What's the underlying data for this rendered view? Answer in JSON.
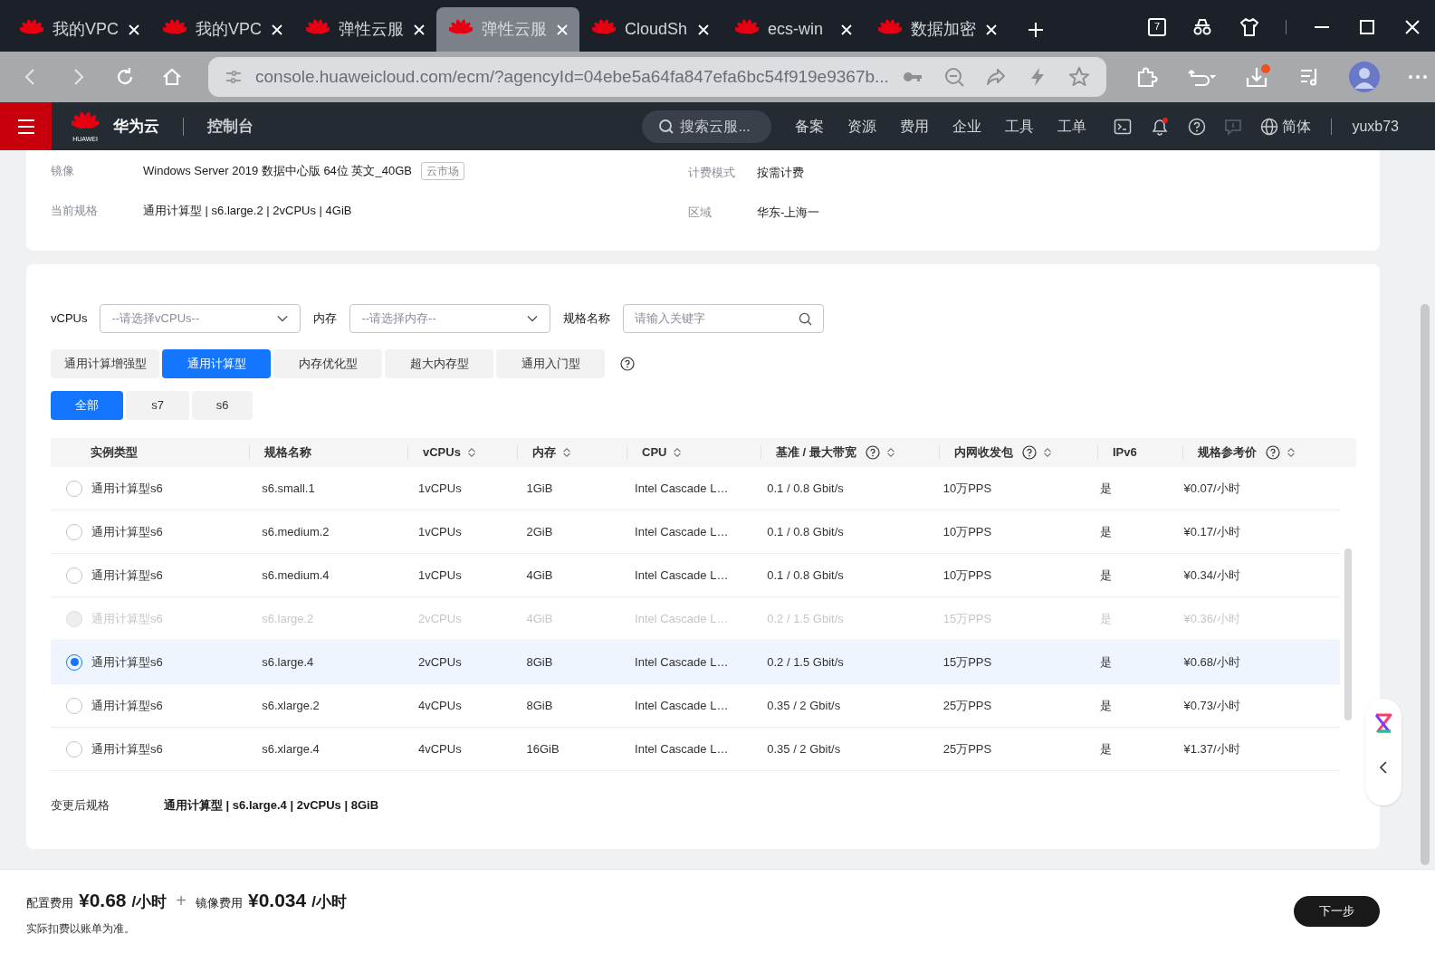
{
  "browser": {
    "tabs": [
      {
        "title": "我的VPC",
        "selected": false
      },
      {
        "title": "我的VPC",
        "selected": false
      },
      {
        "title": "弹性云服",
        "selected": false
      },
      {
        "title": "弹性云服",
        "selected": true
      },
      {
        "title": "CloudSh",
        "selected": false
      },
      {
        "title": "ecs-win",
        "selected": false
      },
      {
        "title": "数据加密",
        "selected": false
      }
    ],
    "tab_count": "7",
    "address": "console.huaweicloud.com/ecm/?agencyId=04ebe5a64fa847efa6bc54f919e9367b..."
  },
  "console_header": {
    "logo_text": "HUAWEI",
    "brand": "华为云",
    "section": "控制台",
    "search_placeholder": "搜索云服...",
    "nav": [
      "备案",
      "资源",
      "费用",
      "企业",
      "工具",
      "工单"
    ],
    "language": "简体",
    "user": "yuxb73"
  },
  "info": {
    "left": [
      {
        "label": "镜像",
        "value": "Windows Server 2019 数据中心版 64位 英文_40GB",
        "tag": "云市场"
      },
      {
        "label": "当前规格",
        "value": "通用计算型 | s6.large.2 | 2vCPUs | 4GiB"
      }
    ],
    "right": [
      {
        "label": "计费模式",
        "value": "按需计费"
      },
      {
        "label": "区域",
        "value": "华东-上海一"
      }
    ]
  },
  "filters": [
    {
      "kind": "select",
      "label": "vCPUs",
      "placeholder": "--请选择vCPUs--"
    },
    {
      "kind": "select",
      "label": "内存",
      "placeholder": "--请选择内存--"
    },
    {
      "kind": "search",
      "label": "规格名称",
      "placeholder": "请输入关键字"
    }
  ],
  "type_tabs": [
    {
      "label": "通用计算增强型",
      "selected": false
    },
    {
      "label": "通用计算型",
      "selected": true
    },
    {
      "label": "内存优化型",
      "selected": false
    },
    {
      "label": "超大内存型",
      "selected": false
    },
    {
      "label": "通用入门型",
      "selected": false
    }
  ],
  "series_tabs": [
    {
      "label": "全部",
      "selected": true
    },
    {
      "label": "s7",
      "selected": false
    },
    {
      "label": "s6",
      "selected": false
    }
  ],
  "table": {
    "columns": [
      {
        "label": "实例类型",
        "sortable": false,
        "help": false
      },
      {
        "label": "规格名称",
        "sortable": false,
        "help": false
      },
      {
        "label": "vCPUs",
        "sortable": true,
        "help": false
      },
      {
        "label": "内存",
        "sortable": true,
        "help": false
      },
      {
        "label": "CPU",
        "sortable": true,
        "help": false
      },
      {
        "label": "基准 / 最大带宽",
        "sortable": true,
        "help": true
      },
      {
        "label": "内网收发包",
        "sortable": true,
        "help": true
      },
      {
        "label": "IPv6",
        "sortable": false,
        "help": false
      },
      {
        "label": "规格参考价",
        "sortable": true,
        "help": true
      }
    ],
    "rows": [
      {
        "selected": false,
        "disabled": false,
        "cells": [
          "通用计算型s6",
          "s6.small.1",
          "1vCPUs",
          "1GiB",
          "Intel Cascade L…",
          "0.1 / 0.8 Gbit/s",
          "10万PPS",
          "是",
          "¥0.07/小时"
        ]
      },
      {
        "selected": false,
        "disabled": false,
        "cells": [
          "通用计算型s6",
          "s6.medium.2",
          "1vCPUs",
          "2GiB",
          "Intel Cascade L…",
          "0.1 / 0.8 Gbit/s",
          "10万PPS",
          "是",
          "¥0.17/小时"
        ]
      },
      {
        "selected": false,
        "disabled": false,
        "cells": [
          "通用计算型s6",
          "s6.medium.4",
          "1vCPUs",
          "4GiB",
          "Intel Cascade L…",
          "0.1 / 0.8 Gbit/s",
          "10万PPS",
          "是",
          "¥0.34/小时"
        ]
      },
      {
        "selected": false,
        "disabled": true,
        "cells": [
          "通用计算型s6",
          "s6.large.2",
          "2vCPUs",
          "4GiB",
          "Intel Cascade L…",
          "0.2 / 1.5 Gbit/s",
          "15万PPS",
          "是",
          "¥0.36/小时"
        ]
      },
      {
        "selected": true,
        "disabled": false,
        "cells": [
          "通用计算型s6",
          "s6.large.4",
          "2vCPUs",
          "8GiB",
          "Intel Cascade L…",
          "0.2 / 1.5 Gbit/s",
          "15万PPS",
          "是",
          "¥0.68/小时"
        ]
      },
      {
        "selected": false,
        "disabled": false,
        "cells": [
          "通用计算型s6",
          "s6.xlarge.2",
          "4vCPUs",
          "8GiB",
          "Intel Cascade L…",
          "0.35 / 2 Gbit/s",
          "25万PPS",
          "是",
          "¥0.73/小时"
        ]
      },
      {
        "selected": false,
        "disabled": false,
        "cells": [
          "通用计算型s6",
          "s6.xlarge.4",
          "4vCPUs",
          "16GiB",
          "Intel Cascade L…",
          "0.35 / 2 Gbit/s",
          "25万PPS",
          "是",
          "¥1.37/小时"
        ]
      }
    ]
  },
  "after_change": {
    "label": "变更后规格",
    "value": "通用计算型 | s6.large.4 | 2vCPUs | 8GiB"
  },
  "footer": {
    "config_label": "配置费用",
    "config_price": "¥0.68",
    "config_unit": "/小时",
    "plus": "+",
    "image_label": "镜像费用",
    "image_price": "¥0.034",
    "image_unit": "/小时",
    "note": "实际扣费以账单为准。",
    "next_button": "下一步"
  }
}
